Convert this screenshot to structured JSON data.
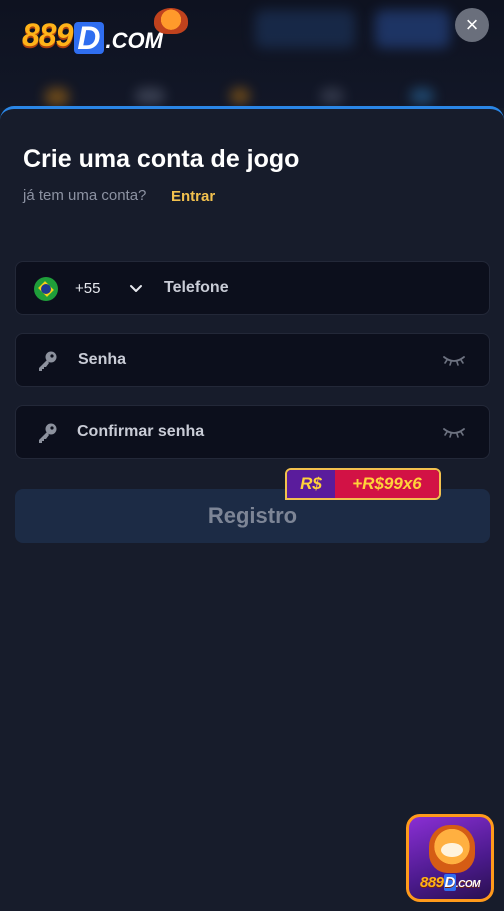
{
  "header": {
    "logo": {
      "number": "889",
      "letter": "D",
      "suffix": ".COM"
    },
    "close_symbol": "×"
  },
  "form": {
    "title": "Crie uma conta de jogo",
    "subtitle": "já tem uma conta?",
    "login_link": "Entrar",
    "phone": {
      "country_code": "+55",
      "placeholder": "Telefone",
      "flag": "brazil-flag-icon"
    },
    "password": {
      "placeholder": "Senha"
    },
    "confirm_password": {
      "placeholder": "Confirmar senha"
    },
    "register_button": "Registro",
    "bonus": {
      "currency": "R$",
      "amount": "+R$99x6"
    }
  },
  "floating_app": {
    "number": "889",
    "letter": "D",
    "suffix": ".COM"
  },
  "colors": {
    "accent": "#2a86e6",
    "link": "#f2c14e",
    "background": "#171c2b",
    "button_disabled": "#1c2b45"
  }
}
